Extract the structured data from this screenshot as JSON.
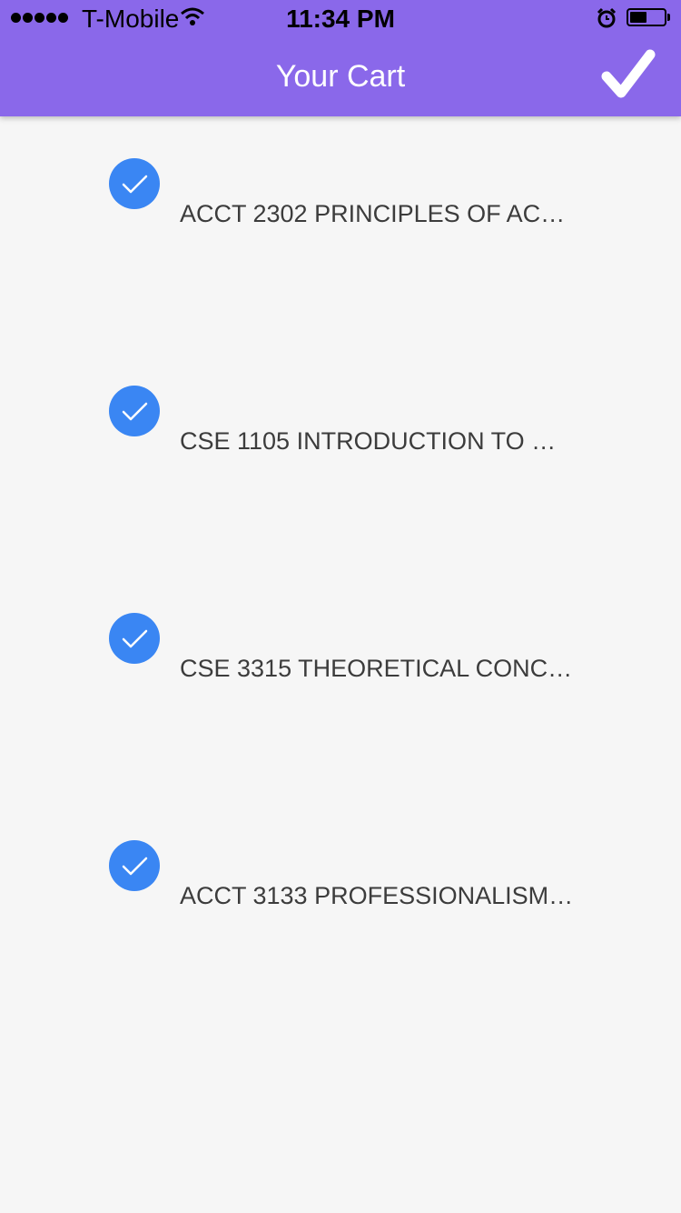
{
  "status_bar": {
    "carrier": "T-Mobile",
    "time": "11:34 PM",
    "battery_level": 0.5
  },
  "header": {
    "title": "Your Cart",
    "done_icon": "checkmark-icon"
  },
  "cart": {
    "items": [
      {
        "label": "ACCT 2302 PRINCIPLES OF AC…",
        "checked": true
      },
      {
        "label": "CSE 1105 INTRODUCTION TO …",
        "checked": true
      },
      {
        "label": "CSE 3315 THEORETICAL CONC…",
        "checked": true
      },
      {
        "label": "ACCT 3133 PROFESSIONALISM…",
        "checked": true
      }
    ]
  },
  "colors": {
    "header": "#8a68ea",
    "check": "#3a86f3",
    "background": "#f6f6f6"
  }
}
